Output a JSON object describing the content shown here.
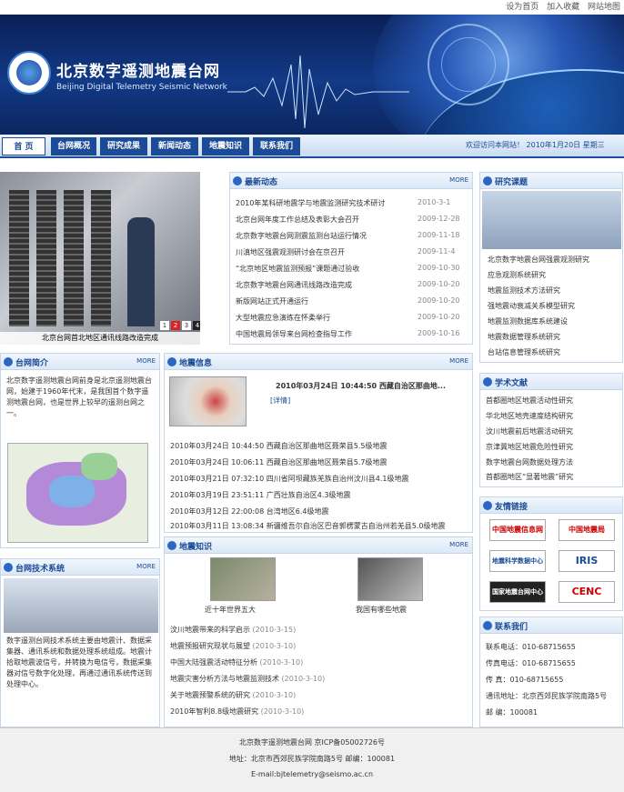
{
  "top_links": [
    "设为首页",
    "加入收藏",
    "网站地图"
  ],
  "header": {
    "title": "北京数字遥测地震台网",
    "subtitle": "Beijing Digital Telemetry Seismic Network"
  },
  "nav": {
    "tabs": [
      "首 页",
      "台网概况",
      "研究成果",
      "新闻动态",
      "地震知识",
      "联系我们"
    ],
    "welcome": "欢迎访问本网站！ 2010年1月20日 星期三"
  },
  "photo": {
    "caption": "北京台网首北地区通讯线路改造完成",
    "pages": [
      "1",
      "2",
      "3",
      "4"
    ]
  },
  "news": {
    "title": "最新动态",
    "more": "MORE",
    "items": [
      {
        "t": "2010年某科研地震学与地震监测研究技术研讨",
        "d": "2010-3-1"
      },
      {
        "t": "北京台网年度工作总结及表彰大会召开",
        "d": "2009-12-28"
      },
      {
        "t": "北京数字地震台网测震监测台站运行情况",
        "d": "2009-11-18"
      },
      {
        "t": "川滇地区强震观测研讨会在京召开",
        "d": "2009-11-4"
      },
      {
        "t": "“北京地区地震监测预报”课题通过验收",
        "d": "2009-10-30"
      },
      {
        "t": "北京数字地震台网通讯线路改造完成",
        "d": "2009-10-20"
      },
      {
        "t": "新版网站正式开通运行",
        "d": "2009-10-20"
      },
      {
        "t": "大型地震应急演练在怀柔举行",
        "d": "2009-10-20"
      },
      {
        "t": "中国地震局领导来台网检查指导工作",
        "d": "2009-10-16"
      }
    ]
  },
  "quake": {
    "title": "地震信息",
    "more": "MORE",
    "headline": "2010年03月24日 10:44:50 西藏自治区那曲地...",
    "detail": "[详情]",
    "items": [
      "2010年03月24日 10:44:50 西藏自治区那曲地区聂荣县5.5级地震",
      "2010年03月24日 10:06:11 西藏自治区那曲地区聂荣县5.7级地震",
      "2010年03月21日 07:32:10 四川省阿坝藏族羌族自治州汶川县4.1级地震",
      "2010年03月19日 23:51:11 广西壮族自治区4.3级地震",
      "2010年03月12日 22:00:08 台湾地区6.4级地震",
      "2010年03月11日 13:08:34 新疆维吾尔自治区巴音郭楞蒙古自治州若羌县5.0级地震"
    ]
  },
  "intro": {
    "title": "台网简介",
    "more": "MORE",
    "text": "北京数字遥测地震台网前身是北京遥测地震台网，始建于1960年代末，是我国首个数字遥测地震台网，也是世界上较早的遥测台网之一。"
  },
  "tech": {
    "title": "台网技术系统",
    "more": "MORE",
    "text": "数字遥测台网技术系统主要由地震计、数据采集器、通讯系统和数据处理系统组成。地震计拾取地震波信号，并转换为电信号，数据采集器对信号数字化处理，再通过通讯系统传送到处理中心。"
  },
  "knowledge": {
    "title": "地震知识",
    "more": "MORE",
    "thumb1": "近十年世界五大",
    "thumb2": "我国有哪些地震",
    "items": [
      {
        "t": "汶川地震带来的科学启示",
        "d": "(2010-3-15)"
      },
      {
        "t": "地震预报研究现状与展望",
        "d": "(2010-3-10)"
      },
      {
        "t": "中国大陆强震活动特征分析",
        "d": "(2010-3-10)"
      },
      {
        "t": "地震灾害分析方法与地震监测技术",
        "d": "(2010-3-10)"
      },
      {
        "t": "关于地震预警系统的研究",
        "d": "(2010-3-10)"
      },
      {
        "t": "2010年智利8.8级地震研究",
        "d": "(2010-3-10)"
      }
    ]
  },
  "research": {
    "title": "研究课题",
    "items": [
      "北京数字地震台网强震观测研究",
      "应急观测系统研究",
      "地震监测技术方法研究",
      "强地震动衰减关系模型研究",
      "地震监测数据库系统建设",
      "地震数据管理系统研究",
      "台站信息管理系统研究"
    ]
  },
  "papers": {
    "title": "学术文献",
    "items": [
      "首都圈地区地震活动性研究",
      "华北地区地壳速度结构研究",
      "汶川地震前后地震活动研究",
      "京津冀地区地震危险性研究",
      "数字地震台网数据处理方法",
      "首都圈地区“显著地震”研究"
    ]
  },
  "links": {
    "title": "友情链接",
    "items": [
      "中国地震信息网",
      "中国地震局",
      "地震科学数据中心",
      "IRIS",
      "国家地震台网中心",
      "CENC"
    ]
  },
  "contact": {
    "title": "联系我们",
    "rows": [
      "联系电话：010-68715655",
      "传真电话：010-68715655",
      "传  真：010-68715655",
      "通讯地址：北京西郊民族学院南路5号",
      "邮  编：100081"
    ]
  },
  "footer": {
    "lines": [
      "北京数字遥测地震台网 京ICP备05002726号",
      "地址：北京市西郊民族学院南路5号 邮编：100081",
      "E-mail:bjtelemetry@seismo.ac.cn"
    ]
  },
  "colors": {
    "primary": "#1b4a96",
    "banner": "#0a1f55"
  }
}
